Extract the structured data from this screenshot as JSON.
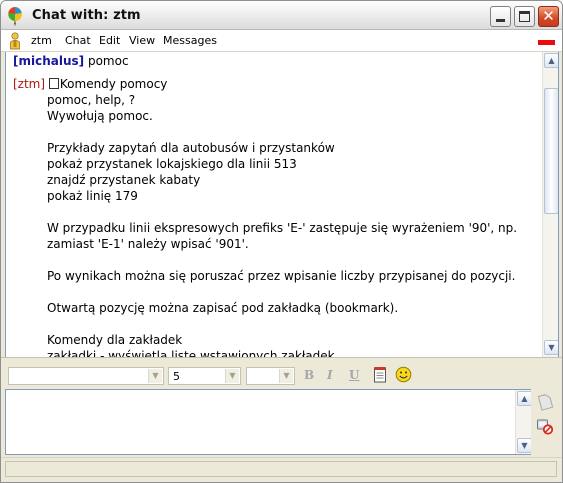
{
  "window": {
    "title": "Chat with: ztm"
  },
  "menu": {
    "items": [
      "ztm",
      "Chat",
      "Edit",
      "View",
      "Messages"
    ]
  },
  "log": {
    "me_nick": "[michalus]",
    "me_text": "pomoc",
    "other_nick": "[ztm]",
    "other_first": "Komendy pomocy",
    "lines": [
      "pomoc, help, ?",
      "Wywołują pomoc.",
      "",
      "Przykłady zapytań dla autobusów i przystanków",
      "pokaż przystanek lokajskiego dla linii 513",
      "znajdź przystanek kabaty",
      "pokaż linię 179",
      "",
      "W przypadku linii ekspresowych prefiks 'E-' zastępuje się wyrażeniem '90', np.",
      "zamiast 'E-1' należy wpisać '901'.",
      "",
      "Po wynikach można się poruszać przez wpisanie liczby przypisanej do pozycji.",
      "",
      "Otwartą pozycję można zapisać pod zakładką (bookmark).",
      "",
      "Komendy dla zakładek",
      "zakładki - wyświetla listę wstawionych zakładek"
    ]
  },
  "toolbar": {
    "font_value": "",
    "size_value": "5",
    "color_value": "",
    "bold_label": "B",
    "italic_label": "I",
    "underline_label": "U"
  },
  "icons": {
    "app": "balloon-icon",
    "buddy": "user-icon",
    "insert": "notepad-icon",
    "emoticon": "smiley-icon",
    "send_file": "file-icon",
    "block": "block-contact-icon"
  },
  "colors": {
    "my_nick": "#16189c",
    "their_nick": "#a9190f",
    "status_indicator": "#ea0b0b"
  }
}
